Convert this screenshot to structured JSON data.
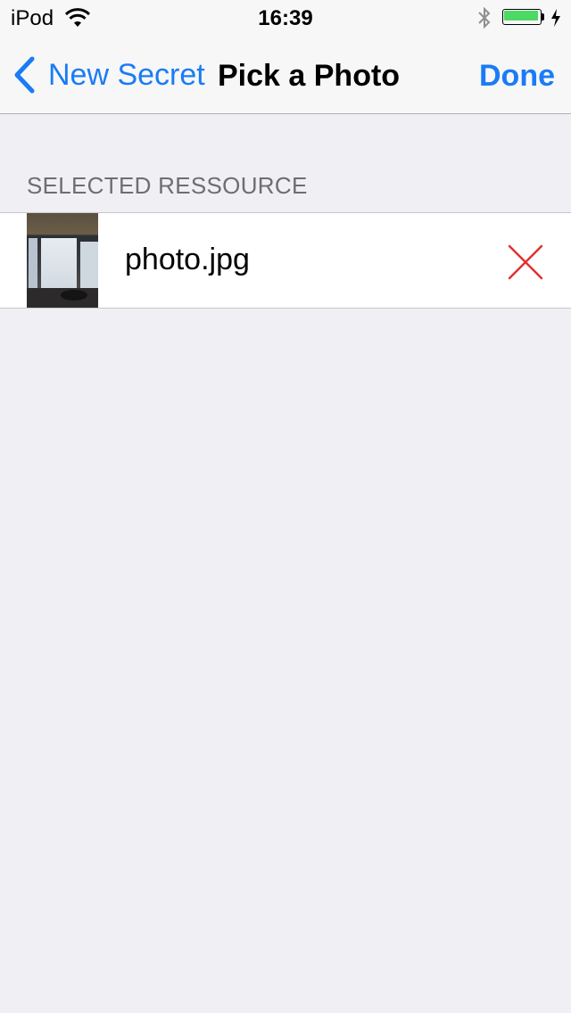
{
  "status_bar": {
    "device": "iPod",
    "time": "16:39",
    "battery_color": "#4cd964"
  },
  "nav": {
    "back_label": "New Secret",
    "title": "Pick a Photo",
    "done_label": "Done",
    "tint_color": "#1a7cf5"
  },
  "section": {
    "header": "SELECTED RESSOURCE"
  },
  "resource": {
    "filename": "photo.jpg",
    "remove_color": "#e0312f",
    "icons": {
      "thumbnail": "photo-thumbnail",
      "remove": "close-icon"
    }
  }
}
